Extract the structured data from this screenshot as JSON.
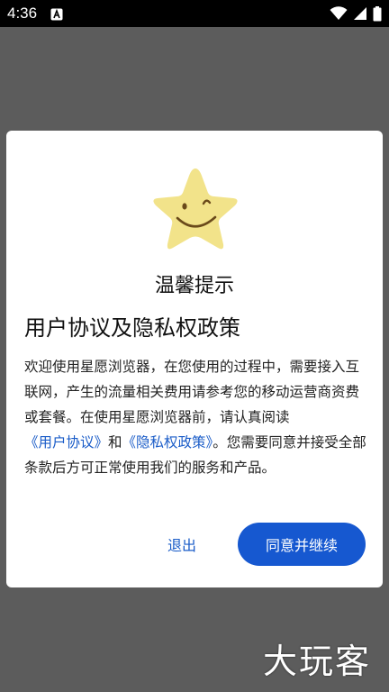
{
  "status_bar": {
    "time": "4:36",
    "icons": [
      "a-icon",
      "wifi-icon",
      "signal-icon",
      "battery-icon"
    ]
  },
  "dialog": {
    "mascot": "winking-star-icon",
    "title": "温馨提示",
    "heading": "用户协议及隐私权政策",
    "body": {
      "text_1": "欢迎使用星愿浏览器，在您使用的过程中，需要接入互联网，产生的流量相关费用请参考您的移动运营商资费或套餐。在使用星愿浏览器前，请认真阅读",
      "link_user_agreement": "《用户协议》",
      "text_2": "和",
      "link_privacy_policy": "《隐私权政策》",
      "text_3": "。您需要同意并接受全部条款后方可正常使用我们的服务和产品。"
    },
    "exit_label": "退出",
    "agree_label": "同意并继续"
  },
  "watermark": "大玩客",
  "colors": {
    "accent": "#1658d0",
    "link": "#1a5cc8",
    "overlay": "#5c5c5c",
    "star": "#f2e38a"
  }
}
